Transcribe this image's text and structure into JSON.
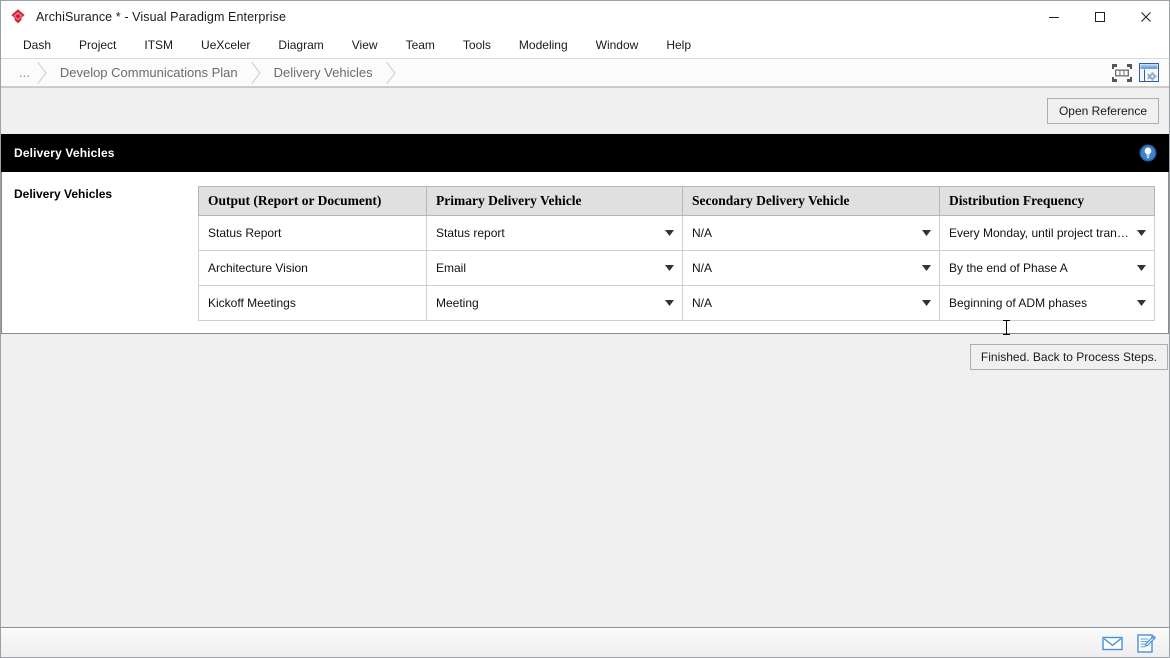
{
  "window": {
    "title": "ArchiSurance * - Visual Paradigm Enterprise",
    "logo_icon": "visual-paradigm-diamond-logo",
    "controls": {
      "minimize": "minimize-icon",
      "maximize": "maximize-icon",
      "close": "close-icon"
    }
  },
  "menubar": {
    "items": [
      {
        "label": "Dash"
      },
      {
        "label": "Project"
      },
      {
        "label": "ITSM"
      },
      {
        "label": "UeXceler"
      },
      {
        "label": "Diagram"
      },
      {
        "label": "View"
      },
      {
        "label": "Team"
      },
      {
        "label": "Tools"
      },
      {
        "label": "Modeling"
      },
      {
        "label": "Window"
      },
      {
        "label": "Help"
      }
    ]
  },
  "breadcrumb": {
    "items": [
      {
        "label": "..."
      },
      {
        "label": "Develop Communications Plan"
      },
      {
        "label": "Delivery Vehicles"
      }
    ],
    "icons": [
      {
        "name": "fit-to-screen-icon"
      },
      {
        "name": "window-settings-icon"
      }
    ]
  },
  "toolstrip": {
    "open_reference_label": "Open Reference"
  },
  "section": {
    "title": "Delivery Vehicles",
    "badge_icon": "info-bulb-icon"
  },
  "form": {
    "label": "Delivery Vehicles"
  },
  "table": {
    "columns": [
      "Output (Report or Document)",
      "Primary Delivery Vehicle",
      "Secondary Delivery Vehicle",
      "Distribution Frequency"
    ],
    "rows": [
      {
        "output": "Status Report",
        "primary": "Status report",
        "secondary": "N/A",
        "frequency": "Every Monday, until project transition"
      },
      {
        "output": "Architecture Vision",
        "primary": "Email",
        "secondary": "N/A",
        "frequency": "By the end of Phase A"
      },
      {
        "output": "Kickoff Meetings",
        "primary": "Meeting",
        "secondary": "N/A",
        "frequency": "Beginning of ADM phases"
      }
    ]
  },
  "footer_actions": {
    "finished_label": "Finished. Back to Process Steps."
  },
  "statusbar": {
    "icons": [
      {
        "name": "mail-icon"
      },
      {
        "name": "note-edit-icon"
      }
    ]
  },
  "colors": {
    "section_header_bg": "#000000",
    "table_header_bg": "#e0e0e0",
    "chrome_bg": "#f0f0f0",
    "accent_blue": "#3a72b8",
    "logo_red": "#cf1f2e"
  }
}
